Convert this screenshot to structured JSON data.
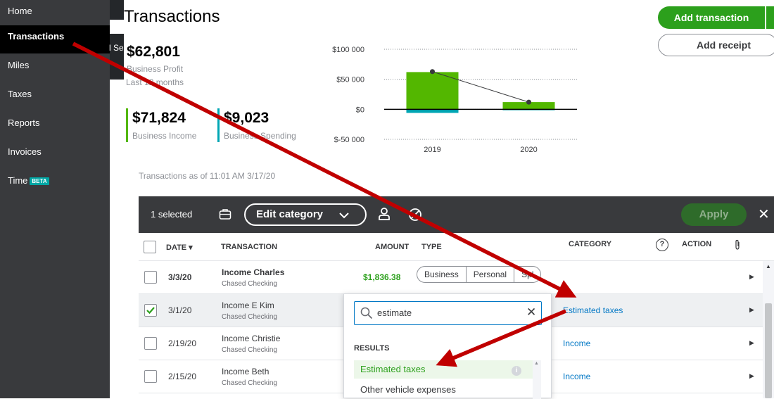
{
  "sidebar": {
    "items": [
      {
        "label": "Home"
      },
      {
        "label": "Transactions"
      },
      {
        "label": "Miles"
      },
      {
        "label": "Taxes"
      },
      {
        "label": "Reports"
      },
      {
        "label": "Invoices"
      },
      {
        "label": "Time",
        "badge": "BETA"
      }
    ],
    "partial_text": "l Se"
  },
  "page": {
    "title": "Transactions",
    "profit_value": "$62,801",
    "profit_label": "Business Profit",
    "profit_period": "Last 12 months",
    "income_value": "$71,824",
    "income_label": "Business Income",
    "spending_value": "$9,023",
    "spending_label": "Business Spending",
    "asof": "Transactions as of 11:01 AM 3/17/20"
  },
  "actions": {
    "add_transaction": "Add transaction",
    "add_receipt": "Add receipt"
  },
  "chart_data": {
    "type": "bar",
    "categories": [
      "2019",
      "2020"
    ],
    "series": [
      {
        "values": [
          62000,
          12000
        ],
        "color": "#53b700"
      },
      {
        "values": [
          -6000,
          -1500
        ],
        "color": "#00a6b4"
      }
    ],
    "profit_line": [
      62801,
      12000
    ],
    "ylim": [
      -50000,
      100000
    ],
    "yticks": [
      "$100 000",
      "$50 000",
      "$0",
      "$-50 000"
    ]
  },
  "toolbar": {
    "selected_text": "1 selected",
    "edit_category": "Edit category",
    "apply": "Apply"
  },
  "table": {
    "headers": {
      "date": "DATE ▾",
      "transaction": "TRANSACTION",
      "amount": "AMOUNT",
      "type": "TYPE",
      "category": "CATEGORY",
      "help": "?",
      "action": "ACTION"
    },
    "rows": [
      {
        "date": "3/3/20",
        "name": "Income Charles",
        "account": "Chased Checking",
        "amount": "$1,836.38",
        "category": ""
      },
      {
        "date": "3/1/20",
        "name": "Income E Kim",
        "account": "Chased Checking",
        "amount": "",
        "category": "Estimated taxes"
      },
      {
        "date": "2/19/20",
        "name": "Income Christie",
        "account": "Chased Checking",
        "amount": "",
        "category": "Income"
      },
      {
        "date": "2/15/20",
        "name": "Income Beth",
        "account": "Chased Checking",
        "amount": "",
        "category": "Income"
      }
    ],
    "type_options": [
      "Business",
      "Personal",
      "Spl"
    ]
  },
  "dropdown": {
    "search_value": "estimate",
    "results_label": "RESULTS",
    "options": [
      "Estimated taxes",
      "Other vehicle expenses"
    ]
  },
  "colors": {
    "accent_green": "#2ca01c",
    "link_blue": "#0077c5",
    "sidebar_bg": "#393a3d",
    "annotation_red": "#c00000"
  }
}
